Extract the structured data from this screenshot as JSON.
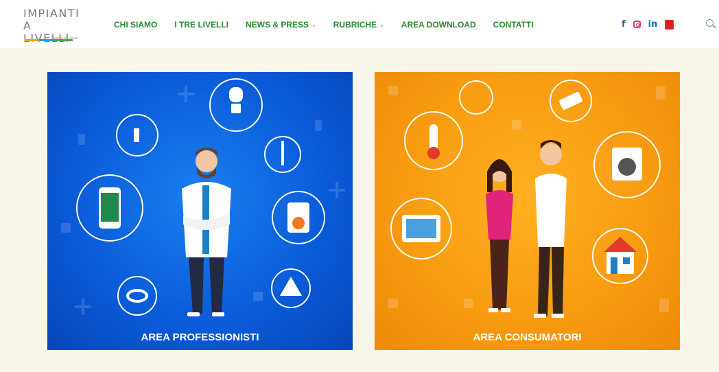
{
  "logo": {
    "line1": "IMPIANTI",
    "line2": "A LIVELLI",
    "tagline": "Sempre più Smart"
  },
  "nav": [
    {
      "label": "CHI SIAMO",
      "has_dropdown": false
    },
    {
      "label": "I TRE LIVELLI",
      "has_dropdown": false
    },
    {
      "label": "NEWS & PRESS",
      "has_dropdown": true
    },
    {
      "label": "RUBRICHE",
      "has_dropdown": true
    },
    {
      "label": "AREA DOWNLOAD",
      "has_dropdown": false
    },
    {
      "label": "CONTATTI",
      "has_dropdown": false
    }
  ],
  "social": {
    "facebook": "f",
    "instagram": "instagram-icon",
    "linkedin": "in",
    "youtube": "youtube-icon"
  },
  "cards": [
    {
      "label": "AREA PROFESSIONISTI",
      "color": "#0a5ad8"
    },
    {
      "label": "AREA CONSUMATORI",
      "color": "#f79a10"
    }
  ],
  "colors": {
    "nav_text": "#2a8a2e",
    "page_bg": "#f7f6e8"
  }
}
